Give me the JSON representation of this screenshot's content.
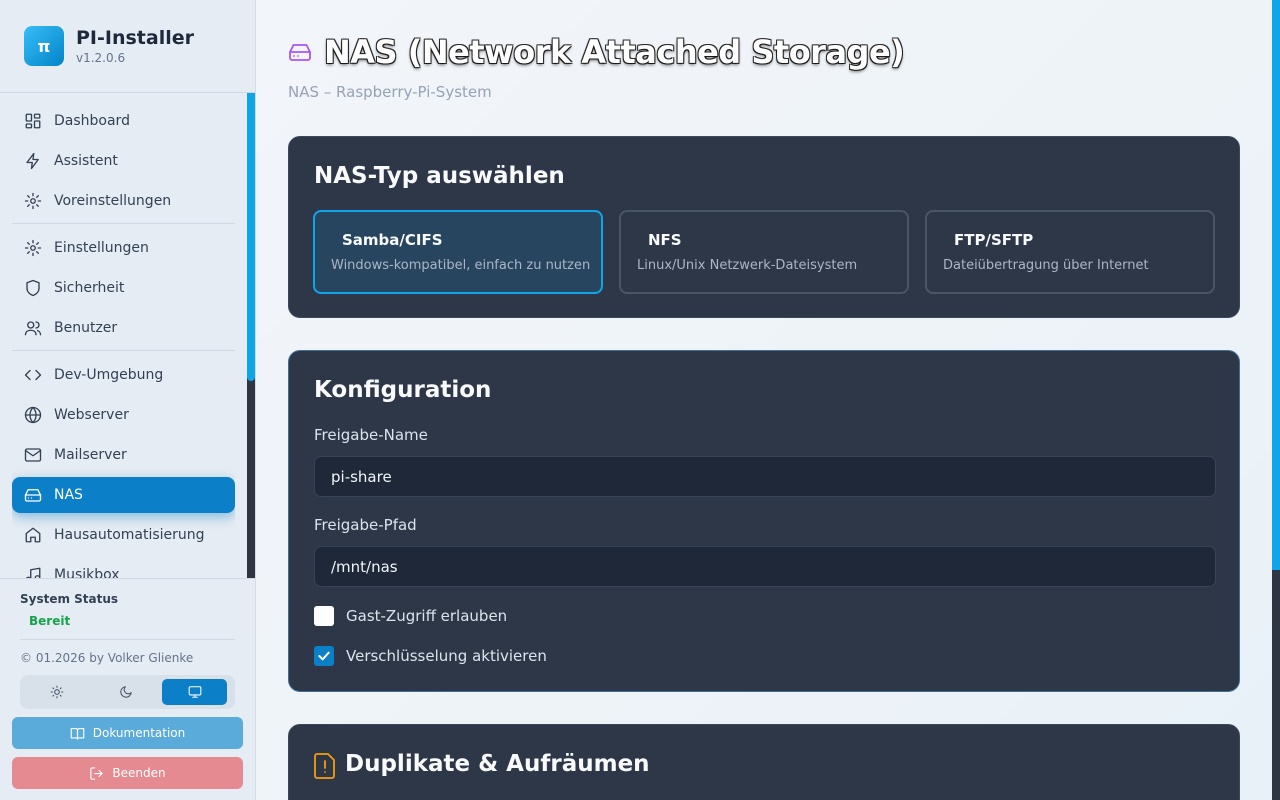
{
  "app": {
    "title": "PI-Installer",
    "version": "v1.2.0.6",
    "logo_glyph": "π"
  },
  "sidebar": {
    "items": [
      {
        "label": "Dashboard",
        "icon": "grid-icon"
      },
      {
        "label": "Assistent",
        "icon": "lightning-icon"
      },
      {
        "label": "Voreinstellungen",
        "icon": "gear-icon"
      },
      {
        "label": "Einstellungen",
        "icon": "gear-icon"
      },
      {
        "label": "Sicherheit",
        "icon": "shield-icon"
      },
      {
        "label": "Benutzer",
        "icon": "users-icon"
      },
      {
        "label": "Dev-Umgebung",
        "icon": "code-icon"
      },
      {
        "label": "Webserver",
        "icon": "globe-icon"
      },
      {
        "label": "Mailserver",
        "icon": "mail-icon"
      },
      {
        "label": "NAS",
        "icon": "hard-drive-icon",
        "active": true
      },
      {
        "label": "Hausautomatisierung",
        "icon": "home-icon"
      },
      {
        "label": "Musikbox",
        "icon": "music-icon"
      }
    ],
    "status_title": "System Status",
    "status_value": "Bereit",
    "copyright": "© 01.2026 by Volker Glienke",
    "theme_selected": "system",
    "doc_button": "Dokumentation",
    "quit_button": "Beenden"
  },
  "page": {
    "title": "NAS (Network Attached Storage)",
    "subtitle": "NAS – Raspberry-Pi-System"
  },
  "nas_type": {
    "title": "NAS-Typ auswählen",
    "options": [
      {
        "name": "Samba/CIFS",
        "desc": "Windows-kompatibel, einfach zu nutzen",
        "selected": true
      },
      {
        "name": "NFS",
        "desc": "Linux/Unix Netzwerk-Dateisystem",
        "selected": false
      },
      {
        "name": "FTP/SFTP",
        "desc": "Dateiübertragung über Internet",
        "selected": false
      }
    ]
  },
  "config": {
    "title": "Konfiguration",
    "share_name_label": "Freigabe-Name",
    "share_name_value": "pi-share",
    "share_path_label": "Freigabe-Pfad",
    "share_path_value": "/mnt/nas",
    "guest_label": "Gast-Zugriff erlauben",
    "guest_checked": false,
    "encryption_label": "Verschlüsselung aktivieren",
    "encryption_checked": true
  },
  "duplicates": {
    "title": "Duplikate & Aufräumen"
  },
  "colors": {
    "accent": "#0b7fc7",
    "card_bg": "#2e3748",
    "status_ok": "#16a34a",
    "title_icon": "#a855f7",
    "warning_icon": "#f59e0b"
  }
}
